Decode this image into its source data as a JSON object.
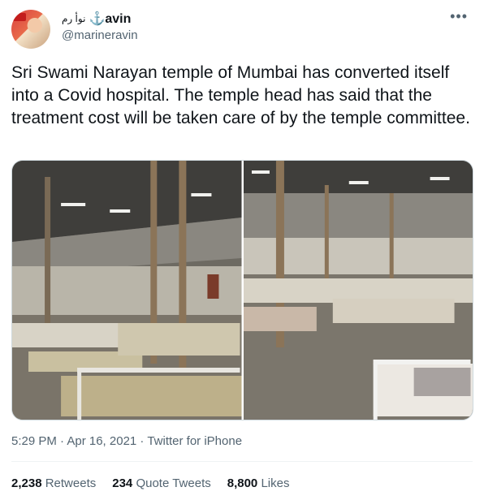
{
  "tweet": {
    "display_name_prefix": "⚓avin",
    "display_name_rtl": "نوأ رم",
    "handle": "@marineravin",
    "text": "Sri Swami Narayan temple of Mumbai has converted itself into a Covid hospital. The temple head has said that the treatment cost will be taken care of by the temple committee.",
    "time": "5:29 PM · Apr 16, 2021",
    "separator": " · ",
    "source": "Twitter for iPhone",
    "more_icon": "more-horizontal-icon"
  },
  "stats": [
    {
      "count": "2,238",
      "label": "Retweets"
    },
    {
      "count": "234",
      "label": "Quote Tweets"
    },
    {
      "count": "8,800",
      "label": "Likes"
    }
  ],
  "colors": {
    "text": "#0f1419",
    "secondary": "#536471",
    "border": "#cfd9de"
  }
}
